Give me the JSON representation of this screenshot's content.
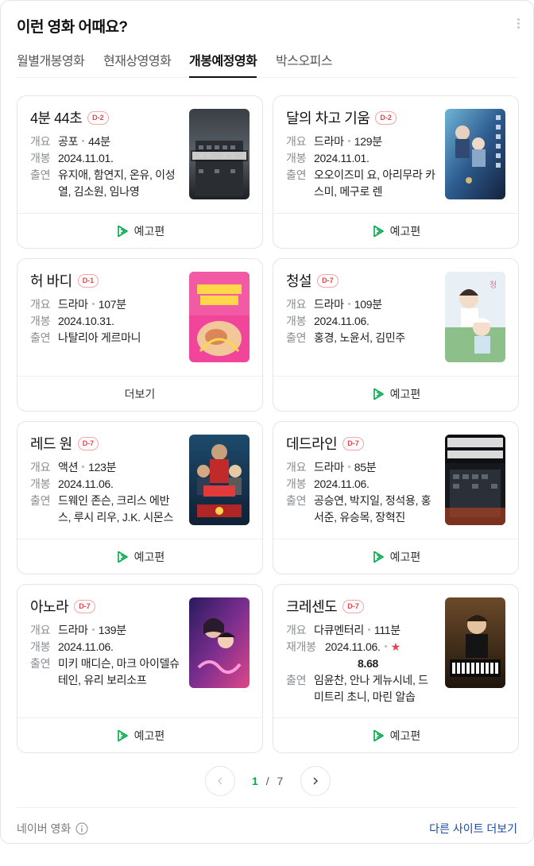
{
  "header": {
    "title": "이런 영화 어때요?",
    "more_icon": "more-vertical-icon"
  },
  "tabs": [
    {
      "label": "월별개봉영화",
      "active": false
    },
    {
      "label": "현재상영영화",
      "active": false
    },
    {
      "label": "개봉예정영화",
      "active": true
    },
    {
      "label": "박스오피스",
      "active": false
    }
  ],
  "labels": {
    "overview": "개요",
    "release": "개봉",
    "rerelease": "재개봉",
    "cast": "출연"
  },
  "movies": [
    {
      "title": "4분 44초",
      "badge": "D-2",
      "genre": "공포",
      "runtime": "44분",
      "date": "2024.11.01.",
      "cast": "유지애, 함연지, 온유, 이성열, 김소원, 임나영",
      "footer": "예고편"
    },
    {
      "title": "달의 차고 기움",
      "badge": "D-2",
      "genre": "드라마",
      "runtime": "129분",
      "date": "2024.11.01.",
      "cast": "오오이즈미 요, 아리무라 카스미, 메구로 렌",
      "footer": "예고편"
    },
    {
      "title": "허 바디",
      "badge": "D-1",
      "genre": "드라마",
      "runtime": "107분",
      "date": "2024.10.31.",
      "cast": "나탈리아 게르마니",
      "footer": "더보기"
    },
    {
      "title": "청설",
      "badge": "D-7",
      "genre": "드라마",
      "runtime": "109분",
      "date": "2024.11.06.",
      "cast": "홍경, 노윤서, 김민주",
      "footer": "예고편"
    },
    {
      "title": "레드 원",
      "badge": "D-7",
      "genre": "액션",
      "runtime": "123분",
      "date": "2024.11.06.",
      "cast": "드웨인 존슨, 크리스 에반스, 루시 리우, J.K. 시몬스",
      "footer": "예고편"
    },
    {
      "title": "데드라인",
      "badge": "D-7",
      "genre": "드라마",
      "runtime": "85분",
      "date": "2024.11.06.",
      "cast": "공승연, 박지일, 정석용, 홍서준, 유승목, 장혁진",
      "footer": "예고편"
    },
    {
      "title": "아노라",
      "badge": "D-7",
      "genre": "드라마",
      "runtime": "139분",
      "date": "2024.11.06.",
      "cast": "미키 매디슨, 마크 아이델슈테인, 유리 보리소프",
      "footer": "예고편"
    },
    {
      "title": "크레센도",
      "badge": "D-7",
      "genre": "다큐멘터리",
      "runtime": "111분",
      "date": "2024.11.06.",
      "rating": "8.68",
      "cast": "임윤찬, 안나 게뉴시네, 드미트리 초니, 마린 알솝",
      "footer": "예고편"
    }
  ],
  "pager": {
    "current": "1",
    "sep": "/",
    "total": "7"
  },
  "footer": {
    "source": "네이버 영화",
    "other_sites": "다른 사이트 더보기"
  },
  "colors": {
    "accent_green": "#03a94d",
    "badge_red": "#e8424b",
    "link_blue": "#1a4ba8"
  }
}
